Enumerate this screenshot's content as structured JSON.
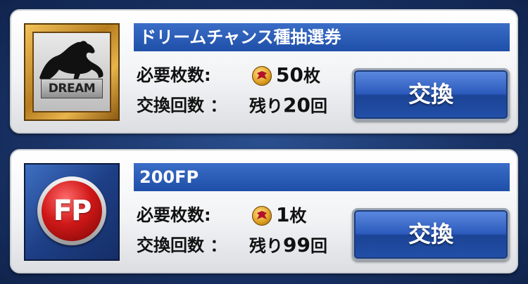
{
  "labels": {
    "required": "必要枚数:",
    "exchange_count": "交換回数 ：",
    "remaining_prefix": "残り",
    "exchange_button": "交換"
  },
  "items": [
    {
      "title": "ドリームチャンス種抽選券",
      "thumbnail_text": "DREAM",
      "cost": "50",
      "cost_unit": "枚",
      "remaining": "20",
      "remaining_unit": "回"
    },
    {
      "title": "200FP",
      "thumbnail_text": "FP",
      "cost": "1",
      "cost_unit": "枚",
      "remaining": "99",
      "remaining_unit": "回"
    }
  ],
  "icons": {
    "medal": "medal-icon",
    "horse": "horse-silhouette-icon"
  },
  "colors": {
    "title_bar": "#1f4fa8",
    "button": "#2c5bbd",
    "fp_ball": "#d01818"
  }
}
